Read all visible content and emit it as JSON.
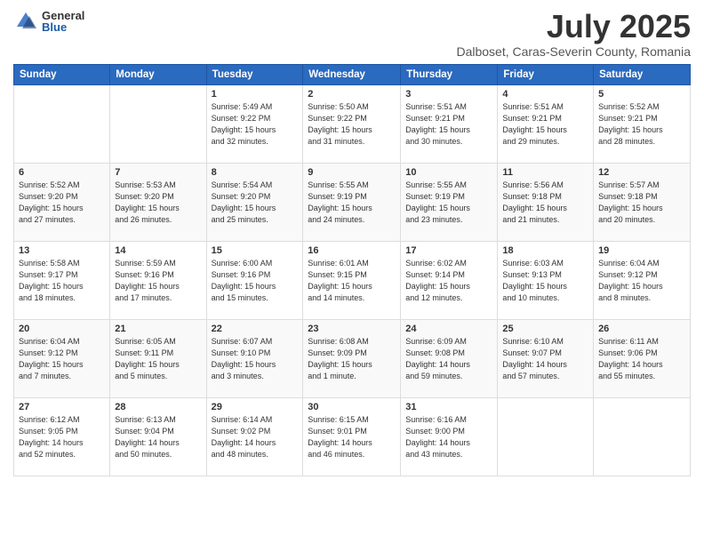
{
  "header": {
    "logo_general": "General",
    "logo_blue": "Blue",
    "month_year": "July 2025",
    "location": "Dalboset, Caras-Severin County, Romania"
  },
  "weekdays": [
    "Sunday",
    "Monday",
    "Tuesday",
    "Wednesday",
    "Thursday",
    "Friday",
    "Saturday"
  ],
  "weeks": [
    [
      {
        "day": "",
        "info": ""
      },
      {
        "day": "",
        "info": ""
      },
      {
        "day": "1",
        "info": "Sunrise: 5:49 AM\nSunset: 9:22 PM\nDaylight: 15 hours\nand 32 minutes."
      },
      {
        "day": "2",
        "info": "Sunrise: 5:50 AM\nSunset: 9:22 PM\nDaylight: 15 hours\nand 31 minutes."
      },
      {
        "day": "3",
        "info": "Sunrise: 5:51 AM\nSunset: 9:21 PM\nDaylight: 15 hours\nand 30 minutes."
      },
      {
        "day": "4",
        "info": "Sunrise: 5:51 AM\nSunset: 9:21 PM\nDaylight: 15 hours\nand 29 minutes."
      },
      {
        "day": "5",
        "info": "Sunrise: 5:52 AM\nSunset: 9:21 PM\nDaylight: 15 hours\nand 28 minutes."
      }
    ],
    [
      {
        "day": "6",
        "info": "Sunrise: 5:52 AM\nSunset: 9:20 PM\nDaylight: 15 hours\nand 27 minutes."
      },
      {
        "day": "7",
        "info": "Sunrise: 5:53 AM\nSunset: 9:20 PM\nDaylight: 15 hours\nand 26 minutes."
      },
      {
        "day": "8",
        "info": "Sunrise: 5:54 AM\nSunset: 9:20 PM\nDaylight: 15 hours\nand 25 minutes."
      },
      {
        "day": "9",
        "info": "Sunrise: 5:55 AM\nSunset: 9:19 PM\nDaylight: 15 hours\nand 24 minutes."
      },
      {
        "day": "10",
        "info": "Sunrise: 5:55 AM\nSunset: 9:19 PM\nDaylight: 15 hours\nand 23 minutes."
      },
      {
        "day": "11",
        "info": "Sunrise: 5:56 AM\nSunset: 9:18 PM\nDaylight: 15 hours\nand 21 minutes."
      },
      {
        "day": "12",
        "info": "Sunrise: 5:57 AM\nSunset: 9:18 PM\nDaylight: 15 hours\nand 20 minutes."
      }
    ],
    [
      {
        "day": "13",
        "info": "Sunrise: 5:58 AM\nSunset: 9:17 PM\nDaylight: 15 hours\nand 18 minutes."
      },
      {
        "day": "14",
        "info": "Sunrise: 5:59 AM\nSunset: 9:16 PM\nDaylight: 15 hours\nand 17 minutes."
      },
      {
        "day": "15",
        "info": "Sunrise: 6:00 AM\nSunset: 9:16 PM\nDaylight: 15 hours\nand 15 minutes."
      },
      {
        "day": "16",
        "info": "Sunrise: 6:01 AM\nSunset: 9:15 PM\nDaylight: 15 hours\nand 14 minutes."
      },
      {
        "day": "17",
        "info": "Sunrise: 6:02 AM\nSunset: 9:14 PM\nDaylight: 15 hours\nand 12 minutes."
      },
      {
        "day": "18",
        "info": "Sunrise: 6:03 AM\nSunset: 9:13 PM\nDaylight: 15 hours\nand 10 minutes."
      },
      {
        "day": "19",
        "info": "Sunrise: 6:04 AM\nSunset: 9:12 PM\nDaylight: 15 hours\nand 8 minutes."
      }
    ],
    [
      {
        "day": "20",
        "info": "Sunrise: 6:04 AM\nSunset: 9:12 PM\nDaylight: 15 hours\nand 7 minutes."
      },
      {
        "day": "21",
        "info": "Sunrise: 6:05 AM\nSunset: 9:11 PM\nDaylight: 15 hours\nand 5 minutes."
      },
      {
        "day": "22",
        "info": "Sunrise: 6:07 AM\nSunset: 9:10 PM\nDaylight: 15 hours\nand 3 minutes."
      },
      {
        "day": "23",
        "info": "Sunrise: 6:08 AM\nSunset: 9:09 PM\nDaylight: 15 hours\nand 1 minute."
      },
      {
        "day": "24",
        "info": "Sunrise: 6:09 AM\nSunset: 9:08 PM\nDaylight: 14 hours\nand 59 minutes."
      },
      {
        "day": "25",
        "info": "Sunrise: 6:10 AM\nSunset: 9:07 PM\nDaylight: 14 hours\nand 57 minutes."
      },
      {
        "day": "26",
        "info": "Sunrise: 6:11 AM\nSunset: 9:06 PM\nDaylight: 14 hours\nand 55 minutes."
      }
    ],
    [
      {
        "day": "27",
        "info": "Sunrise: 6:12 AM\nSunset: 9:05 PM\nDaylight: 14 hours\nand 52 minutes."
      },
      {
        "day": "28",
        "info": "Sunrise: 6:13 AM\nSunset: 9:04 PM\nDaylight: 14 hours\nand 50 minutes."
      },
      {
        "day": "29",
        "info": "Sunrise: 6:14 AM\nSunset: 9:02 PM\nDaylight: 14 hours\nand 48 minutes."
      },
      {
        "day": "30",
        "info": "Sunrise: 6:15 AM\nSunset: 9:01 PM\nDaylight: 14 hours\nand 46 minutes."
      },
      {
        "day": "31",
        "info": "Sunrise: 6:16 AM\nSunset: 9:00 PM\nDaylight: 14 hours\nand 43 minutes."
      },
      {
        "day": "",
        "info": ""
      },
      {
        "day": "",
        "info": ""
      }
    ]
  ]
}
